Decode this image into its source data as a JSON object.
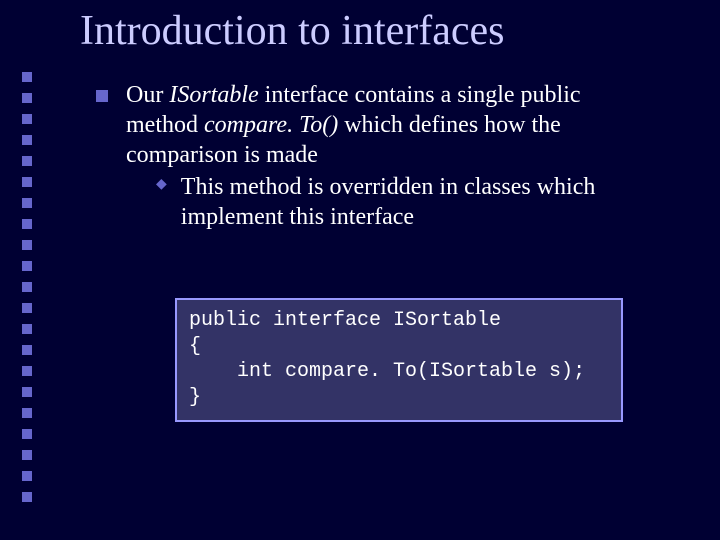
{
  "title": "Introduction to interfaces",
  "bullet": {
    "seg1": "Our ",
    "seg2_italic": "ISortable",
    "seg3": " interface contains a single public method ",
    "seg4_italic": "compare. To()",
    "seg5": " which defines how the comparison is made"
  },
  "subbullet": "This method is overridden in classes which implement this interface",
  "code": {
    "l1": "public interface ISortable",
    "l2": "{",
    "l3": "    int compare. To(ISortable s);",
    "l4": "}"
  }
}
